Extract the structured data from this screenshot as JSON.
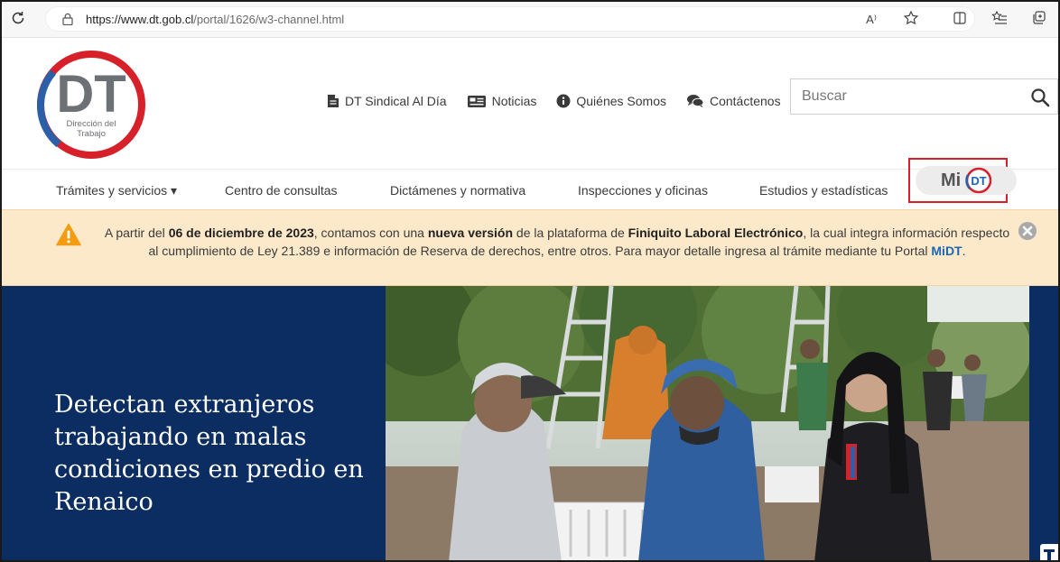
{
  "browser": {
    "url_host": "https://www.dt.gob.cl",
    "url_path": "/portal/1626/w3-channel.html",
    "icons": [
      "reload-icon",
      "lock-icon",
      "read-aloud-icon",
      "favorite-icon",
      "split-screen-icon",
      "favorites-list-icon",
      "collections-icon"
    ],
    "read_aloud_label": "A⁾"
  },
  "logo": {
    "letters": "DT",
    "subtitle_line1": "Dirección del",
    "subtitle_line2": "Trabajo",
    "colors": {
      "red": "#d6202a",
      "blue": "#2b5fa8",
      "dark": "#6d7075"
    }
  },
  "toplinks": [
    {
      "label": "DT Sindical Al Día",
      "icon": "document-icon"
    },
    {
      "label": "Noticias",
      "icon": "newspaper-icon"
    },
    {
      "label": "Quiénes Somos",
      "icon": "info-icon"
    },
    {
      "label": "Contáctenos",
      "icon": "chat-icon"
    }
  ],
  "search": {
    "placeholder": "Buscar"
  },
  "nav": {
    "items": [
      "Trámites y servicios ▾",
      "Centro de consultas",
      "Dictámenes y normativa",
      "Inspecciones y oficinas",
      "Estudios y estadísticas"
    ],
    "midt_prefix": "Mi",
    "midt_badge": "DT"
  },
  "alert": {
    "t1": "A partir del ",
    "b1": "06 de diciembre de 2023",
    "t2": ", contamos con una ",
    "b2": "nueva versión",
    "t3": " de la plataforma de ",
    "b3": "Finiquito Laboral Electrónico",
    "t4": ", la cual integra información respecto al cumplimiento de Ley 21.389 e información de Reserva de derechos, entre otros. Para mayor detalle ingresa al trámite mediante tu Portal ",
    "link": "MiDT",
    "t5": "."
  },
  "hero": {
    "title": "Detectan extranjeros trabajando en malas condiciones en predio en Renaico",
    "background": "#0c2d62"
  }
}
